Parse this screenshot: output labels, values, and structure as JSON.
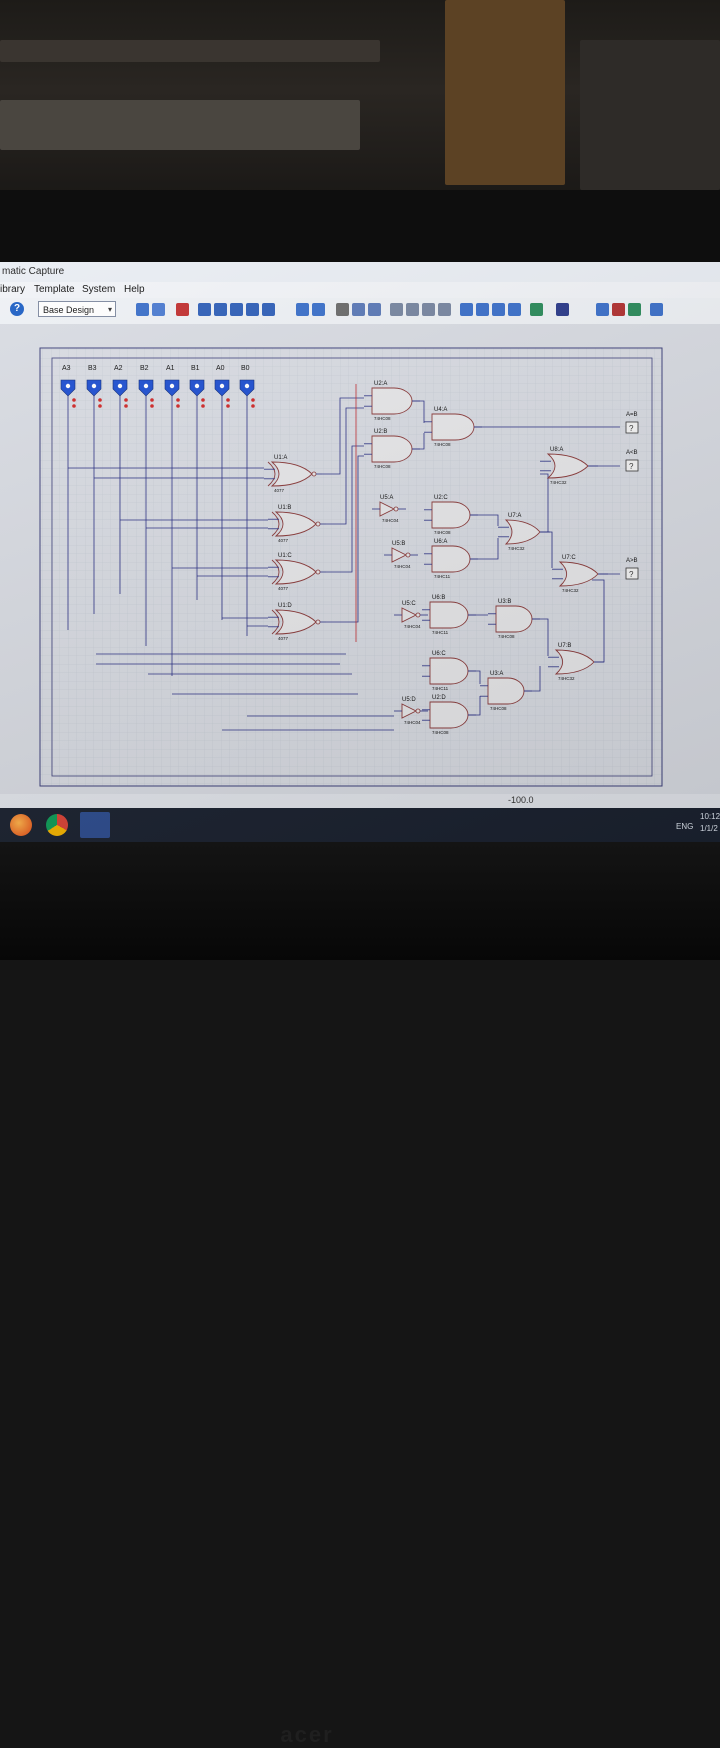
{
  "window": {
    "title": "matic Capture"
  },
  "menu": [
    "ibrary",
    "Template",
    "System",
    "Help"
  ],
  "toolbar": {
    "help_icon": "question-icon",
    "design_select": "Base Design",
    "icons": [
      "page-icon",
      "grid-icon",
      "origin-icon",
      "pan-icon",
      "zoom-in-icon",
      "zoom-out-icon",
      "zoom-all-icon",
      "zoom-area-icon",
      "undo-icon",
      "redo-icon",
      "cut-icon",
      "copy-icon",
      "paste-icon",
      "block-copy-icon",
      "block-move-icon",
      "block-rotate-icon",
      "block-delete-icon",
      "search-icon",
      "wire-autorouter-icon",
      "property-assign-icon",
      "tool-icon",
      "netlist-icon",
      "binoculars-icon",
      "new-sheet-icon",
      "delete-sheet-icon",
      "refresh-icon",
      "export-icon"
    ]
  },
  "inputs": [
    "A3",
    "B3",
    "A2",
    "B2",
    "A1",
    "B1",
    "A0",
    "B0"
  ],
  "components": {
    "u1a": {
      "ref": "U1:A",
      "part": "4077"
    },
    "u1b": {
      "ref": "U1:B",
      "part": "4077"
    },
    "u1c": {
      "ref": "U1:C",
      "part": "4077"
    },
    "u1d": {
      "ref": "U1:D",
      "part": "4077"
    },
    "u2a": {
      "ref": "U2:A",
      "part": "74HC08"
    },
    "u2b": {
      "ref": "U2:B",
      "part": "74HC08"
    },
    "u4a": {
      "ref": "U4:A",
      "part": "74HC08"
    },
    "u8a": {
      "ref": "U8:A",
      "part": "74HC32"
    },
    "u5a": {
      "ref": "U5:A",
      "part": "74HC04"
    },
    "u2c": {
      "ref": "U2:C",
      "part": "74HC08"
    },
    "u7a": {
      "ref": "U7:A",
      "part": "74HC32"
    },
    "u5b": {
      "ref": "U5:B",
      "part": "74HC04"
    },
    "u6a": {
      "ref": "U6:A",
      "part": "74HC11"
    },
    "u7c": {
      "ref": "U7:C",
      "part": "74HC32"
    },
    "u6b": {
      "ref": "U6:B",
      "part": "74HC11"
    },
    "u5c": {
      "ref": "U5:C",
      "part": "74HC04"
    },
    "u3b": {
      "ref": "U3:B",
      "part": "74HC08"
    },
    "u7b": {
      "ref": "U7:B",
      "part": "74HC32"
    },
    "u6c": {
      "ref": "U6:C",
      "part": "74HC11"
    },
    "u3a": {
      "ref": "U3:A",
      "part": "74HC08"
    },
    "u5d": {
      "ref": "U5:D",
      "part": "74HC04"
    },
    "u2d": {
      "ref": "U2:D",
      "part": "74HC08"
    }
  },
  "outputs": {
    "eq": {
      "label": "A=B",
      "value": "?"
    },
    "lt": {
      "label": "A<B",
      "value": "?"
    },
    "gt": {
      "label": "A>B",
      "value": "?"
    }
  },
  "status": {
    "coordinate": "-100.0"
  },
  "tray": {
    "language": "ENG",
    "time": "10:12",
    "date": "1/1/2"
  },
  "taskbar_apps": [
    "firefox-icon",
    "chrome-icon",
    "proteus-icon"
  ],
  "colors": {
    "wire": "#2a2f85",
    "gate": "#8b3a3a",
    "grid": "#c3c8d2",
    "probe": "#1e4fd1",
    "canvas": "#d6dae2"
  }
}
